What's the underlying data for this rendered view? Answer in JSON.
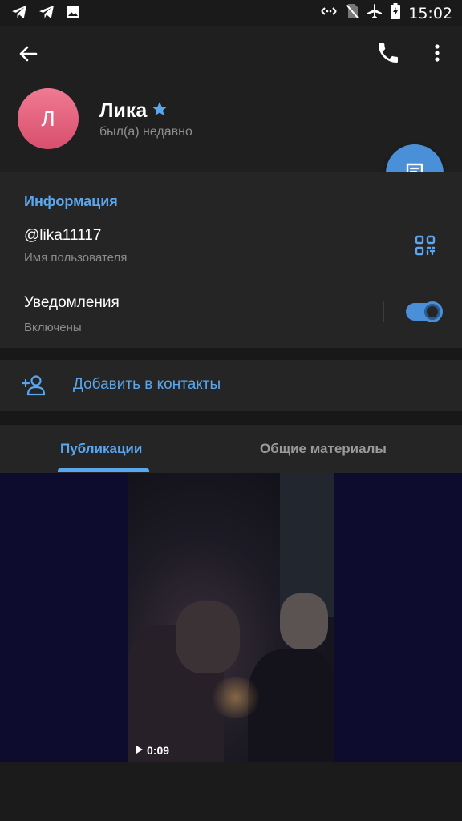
{
  "status_bar": {
    "time": "15:02",
    "left_icons": [
      "telegram-icon",
      "telegram-icon",
      "image-icon"
    ],
    "right_icons": [
      "data-saver-icon",
      "no-sim-icon",
      "airplane-icon",
      "battery-charging-icon"
    ]
  },
  "profile": {
    "avatar_letter": "Л",
    "name": "Лика",
    "status": "был(а) недавно",
    "avatar_color": "#e8637f"
  },
  "info": {
    "title": "Информация",
    "username": "@lika11117",
    "username_label": "Имя пользователя",
    "notifications_label": "Уведомления",
    "notifications_value": "Включены",
    "notifications_enabled": true
  },
  "actions": {
    "add_contact": "Добавить в контакты"
  },
  "tabs": [
    {
      "label": "Публикации",
      "active": true
    },
    {
      "label": "Общие материалы",
      "active": false
    }
  ],
  "media": {
    "video_duration": "0:09"
  },
  "colors": {
    "accent": "#5aa7ef",
    "fab": "#4a90d9",
    "background": "#181818"
  }
}
